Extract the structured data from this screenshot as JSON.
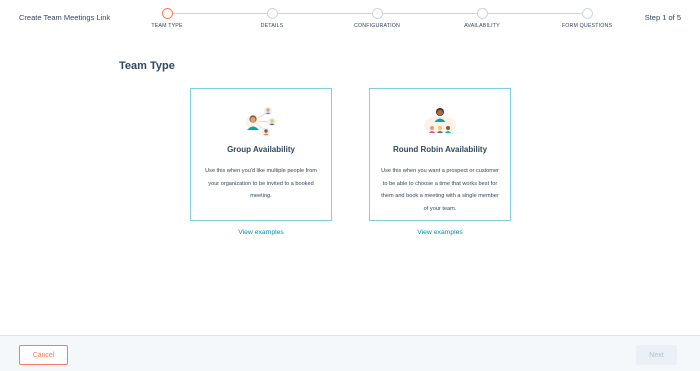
{
  "header": {
    "title": "Create Team Meetings Link",
    "step_count": "Step 1 of 5",
    "steps": [
      {
        "label": "TEAM TYPE",
        "active": true
      },
      {
        "label": "DETAILS",
        "active": false
      },
      {
        "label": "CONFIGURATION",
        "active": false
      },
      {
        "label": "AVAILABILITY",
        "active": false
      },
      {
        "label": "FORM QUESTIONS",
        "active": false
      }
    ]
  },
  "main": {
    "title": "Team Type",
    "cards": [
      {
        "icon": "group-people-illustration",
        "title": "Group Availability",
        "description": "Use this when you'd like multiple people from your organization to be invited to a booked meeting.",
        "link": "View examples"
      },
      {
        "icon": "round-robin-illustration",
        "title": "Round Robin Availability",
        "description": "Use this when you want a prospect or customer to be able to choose a time that works best for them and book a meeting with a single member of your team.",
        "link": "View examples"
      }
    ]
  },
  "footer": {
    "cancel_label": "Cancel",
    "next_label": "Next"
  },
  "colors": {
    "accent": "#ff7a59",
    "link": "#0091ae",
    "card_border": "#7fd1de",
    "text": "#33475b"
  }
}
